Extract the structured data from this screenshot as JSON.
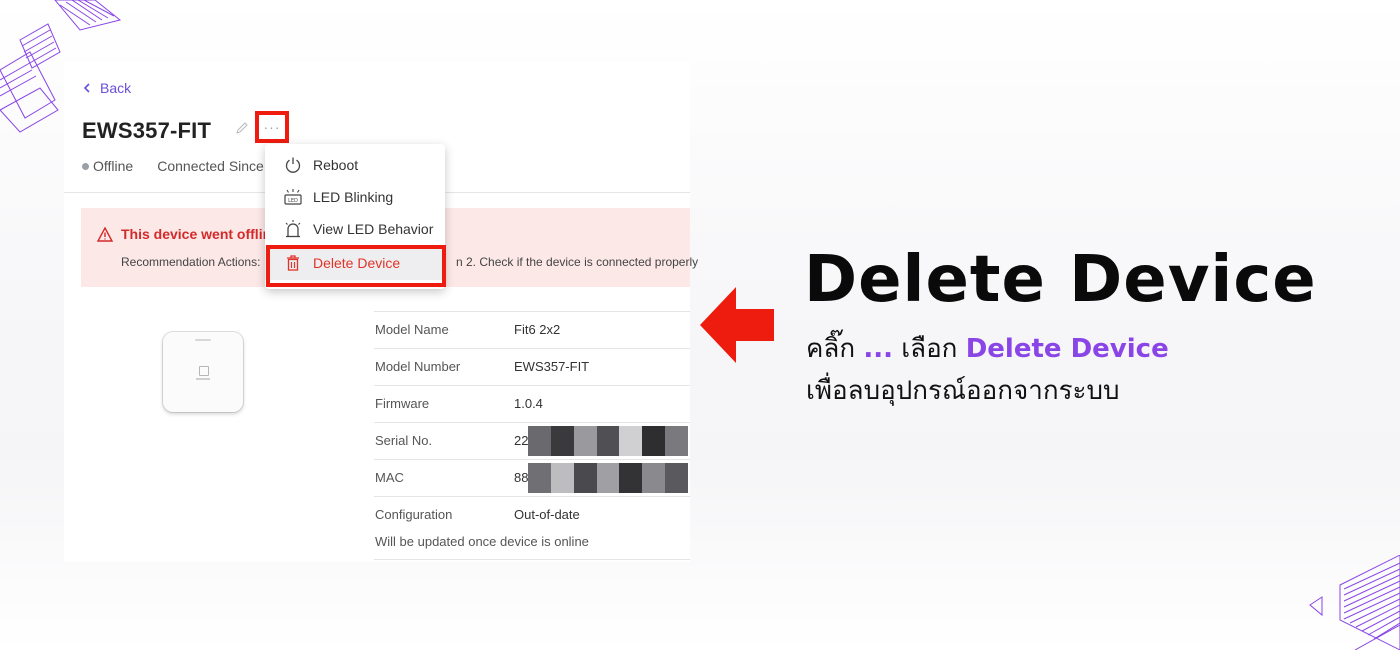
{
  "colors": {
    "accent_red": "#ee1c0f",
    "accent_purple": "#8a45e6",
    "back_link": "#6b4fd8",
    "alert_bg": "#fde8e8",
    "alert_text": "#d32a2a"
  },
  "page": {
    "back_label": "Back",
    "device_title": "EWS357-FIT",
    "more_button_label": "···",
    "status": "Offline",
    "connected_label": "Connected Since"
  },
  "alert": {
    "title": "This device went offline",
    "recommendation_prefix": "Recommendation Actions:",
    "recommendation_tail": "n 2. Check if the device is connected properly"
  },
  "menu": {
    "items": [
      {
        "label": "Reboot",
        "icon": "power-icon"
      },
      {
        "label": "LED Blinking",
        "icon": "led-icon"
      },
      {
        "label": "View LED Behavior",
        "icon": "alarm-icon"
      },
      {
        "label": "Delete Device",
        "icon": "trash-icon"
      }
    ]
  },
  "details": {
    "rows": [
      {
        "key": "Model Name",
        "value": "Fit6 2x2"
      },
      {
        "key": "Model Number",
        "value": "EWS357-FIT"
      },
      {
        "key": "Firmware",
        "value": "1.0.4"
      },
      {
        "key": "Serial No.",
        "value": "22"
      },
      {
        "key": "MAC",
        "value": "88"
      },
      {
        "key": "Configuration",
        "value": "Out-of-date",
        "note": "Will be updated once device is online"
      }
    ]
  },
  "instructions": {
    "headline": "Delete Device",
    "line1_prefix": "คลิ๊ก ",
    "line1_dots": "...",
    "line1_mid": " เลือก ",
    "line1_highlight": "Delete Device",
    "line2": "เพื่อลบอุปกรณ์ออกจากระบบ"
  }
}
